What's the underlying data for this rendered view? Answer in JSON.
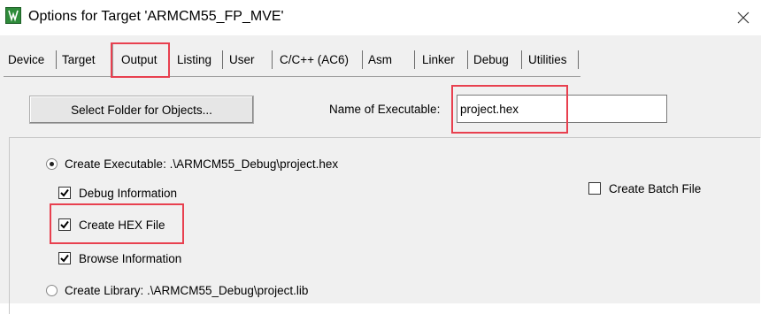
{
  "window": {
    "title": "Options for Target 'ARMCM55_FP_MVE'",
    "close_glyph": "✕"
  },
  "tabs": [
    {
      "label": "Device"
    },
    {
      "label": "Target"
    },
    {
      "label": "Output",
      "active": true
    },
    {
      "label": "Listing"
    },
    {
      "label": "User"
    },
    {
      "label": "C/C++ (AC6)"
    },
    {
      "label": "Asm"
    },
    {
      "label": "Linker"
    },
    {
      "label": "Debug"
    },
    {
      "label": "Utilities"
    }
  ],
  "top": {
    "select_folder_label": "Select Folder for Objects...",
    "name_label": "Name of Executable:",
    "name_value": "project.hex"
  },
  "output": {
    "create_executable_label": "Create Executable:  .\\ARMCM55_Debug\\project.hex",
    "create_executable_selected": true,
    "debug_info_label": "Debug Information",
    "debug_info_checked": true,
    "create_hex_label": "Create HEX File",
    "create_hex_checked": true,
    "browse_info_label": "Browse Information",
    "browse_info_checked": true,
    "create_batch_label": "Create Batch File",
    "create_batch_checked": false,
    "create_library_label": "Create Library:  .\\ARMCM55_Debug\\project.lib",
    "create_library_selected": false
  },
  "colors": {
    "highlight_box": "#e8404f",
    "dialog_bg": "#f0f0f0"
  }
}
